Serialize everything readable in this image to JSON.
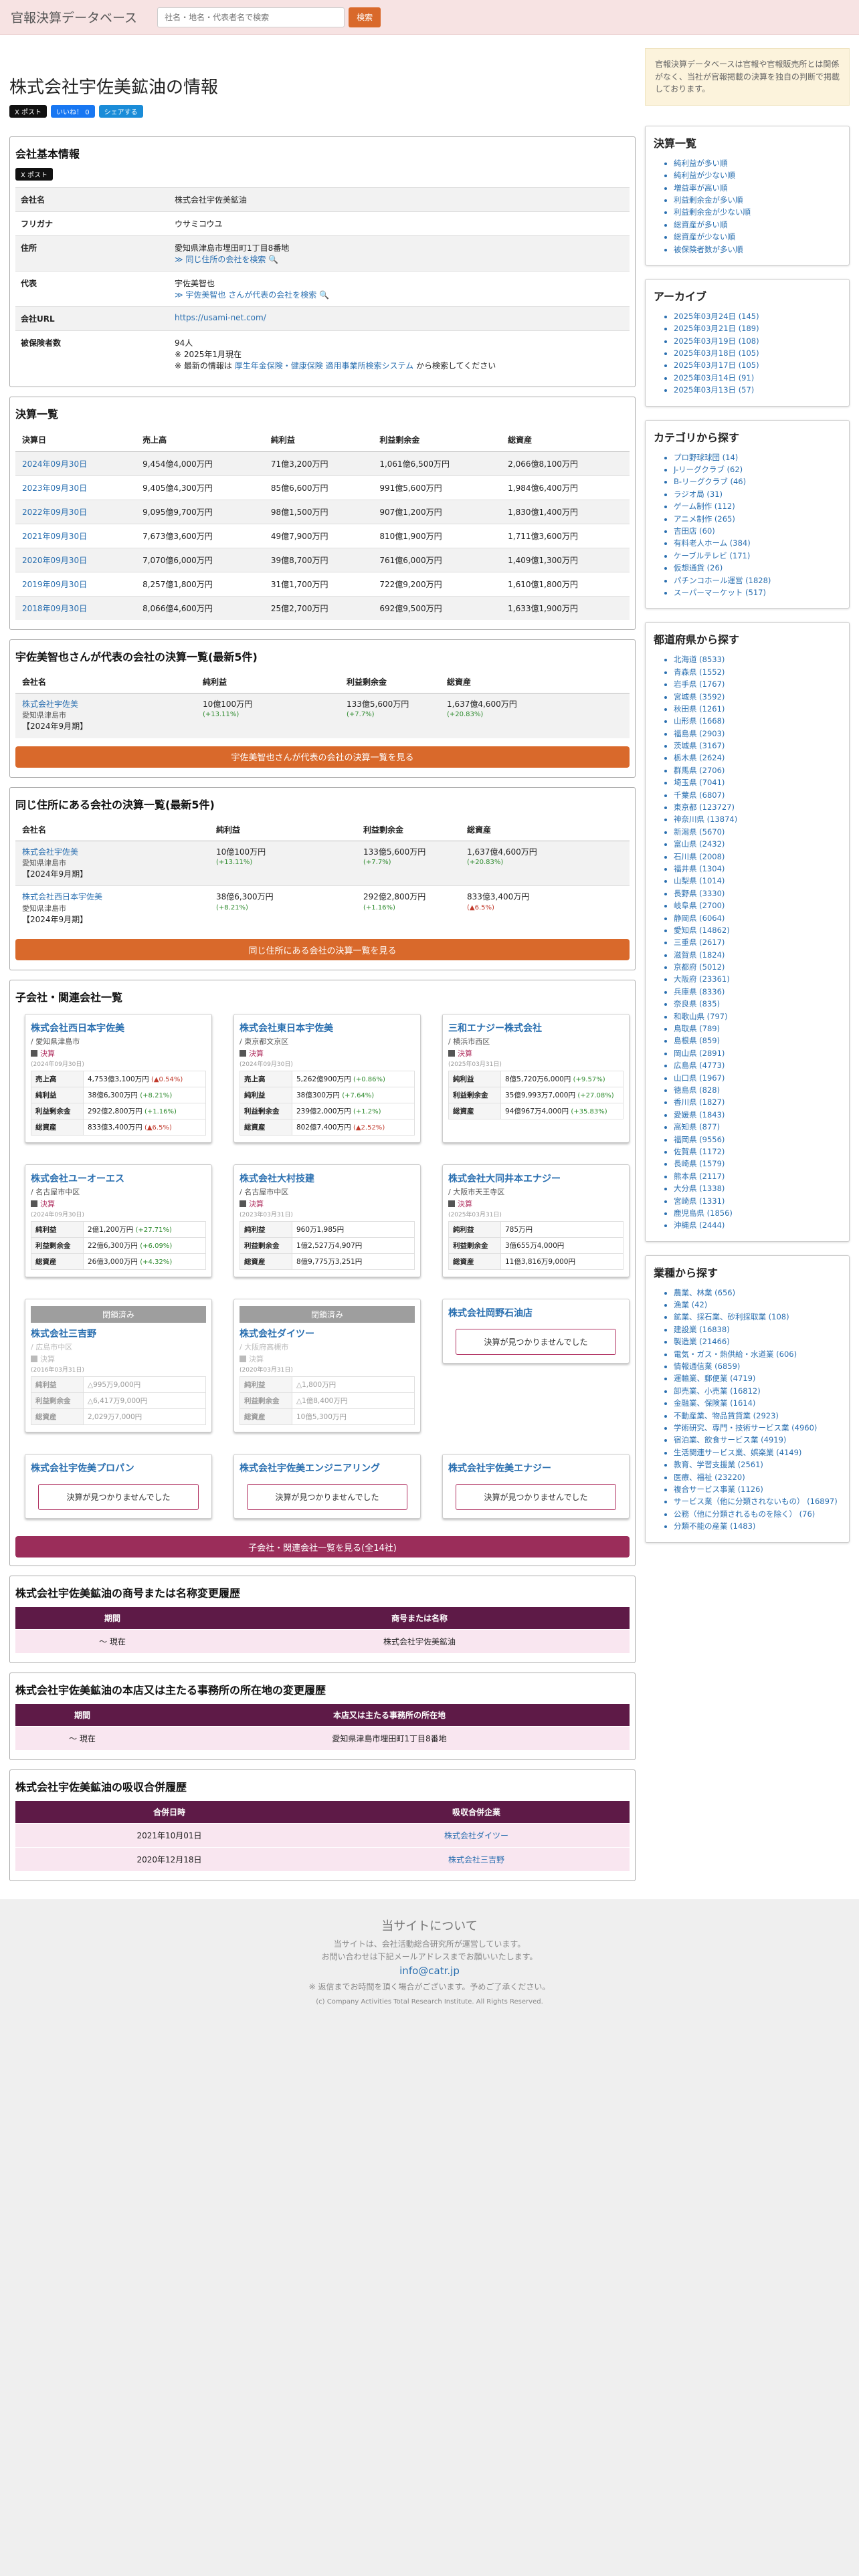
{
  "header": {
    "brand": "官報決算データベース",
    "search_placeholder": "社名・地名・代表者名で検索",
    "search_button": "検索"
  },
  "page_title": "株式会社宇佐美鉱油の情報",
  "social": {
    "post": "X ポスト",
    "like": "いいね！ 0",
    "share": "シェアする"
  },
  "basic": {
    "title": "会社基本情報",
    "post_label": "X ポスト",
    "rows": [
      {
        "k": "会社名",
        "v": "株式会社宇佐美鉱油"
      },
      {
        "k": "フリガナ",
        "v": "ウサミコウユ"
      },
      {
        "k": "住所",
        "v": "愛知県津島市埋田町1丁目8番地",
        "link": "≫ 同じ住所の会社を検索 🔍"
      },
      {
        "k": "代表",
        "v": "宇佐美智也",
        "link": "≫ 宇佐美智也 さんが代表の会社を検索 🔍"
      },
      {
        "k": "会社URL",
        "v": "https://usami-net.com/"
      },
      {
        "k": "被保険者数",
        "v": "94人",
        "v2": "※ 2025年1月現在",
        "v3a": "※ 最新の情報は ",
        "v3link": "厚生年金保険・健康保険 適用事業所検索システム",
        "v3b": " から検索してください"
      }
    ]
  },
  "results": {
    "title": "決算一覧",
    "headers": [
      "決算日",
      "売上高",
      "純利益",
      "利益剰余金",
      "総資産"
    ],
    "rows": [
      [
        "2024年09月30日",
        "9,454億4,000万円",
        "71億3,200万円",
        "1,061億6,500万円",
        "2,066億8,100万円"
      ],
      [
        "2023年09月30日",
        "9,405億4,300万円",
        "85億6,600万円",
        "991億5,600万円",
        "1,984億6,400万円"
      ],
      [
        "2022年09月30日",
        "9,095億9,700万円",
        "98億1,500万円",
        "907億1,200万円",
        "1,830億1,400万円"
      ],
      [
        "2021年09月30日",
        "7,673億3,600万円",
        "49億7,900万円",
        "810億1,900万円",
        "1,711億3,600万円"
      ],
      [
        "2020年09月30日",
        "7,070億6,000万円",
        "39億8,700万円",
        "761億6,000万円",
        "1,409億1,300万円"
      ],
      [
        "2019年09月30日",
        "8,257億1,800万円",
        "31億1,700万円",
        "722億9,200万円",
        "1,610億1,800万円"
      ],
      [
        "2018年09月30日",
        "8,066億4,600万円",
        "25億2,700万円",
        "692億9,500万円",
        "1,633億1,900万円"
      ]
    ]
  },
  "rep": {
    "title": "宇佐美智也さんが代表の会社の決算一覧(最新5件)",
    "headers": [
      "会社名",
      "純利益",
      "利益剰余金",
      "総資産"
    ],
    "rows": [
      {
        "name": "株式会社宇佐美",
        "pref": "愛知県津島市",
        "date": "【2024年9月期】",
        "net": "10億100万円",
        "net_d": "(+13.11%)",
        "ret": "133億5,600万円",
        "ret_d": "(+7.7%)",
        "tot": "1,637億4,600万円",
        "tot_d": "(+20.83%)"
      }
    ],
    "button": "宇佐美智也さんが代表の会社の決算一覧を見る"
  },
  "same_addr": {
    "title": "同じ住所にある会社の決算一覧(最新5件)",
    "headers": [
      "会社名",
      "純利益",
      "利益剰余金",
      "総資産"
    ],
    "rows": [
      {
        "name": "株式会社宇佐美",
        "pref": "愛知県津島市",
        "date": "【2024年9月期】",
        "net": "10億100万円",
        "net_d": "(+13.11%)",
        "ret": "133億5,600万円",
        "ret_d": "(+7.7%)",
        "tot": "1,637億4,600万円",
        "tot_d": "(+20.83%)"
      },
      {
        "name": "株式会社西日本宇佐美",
        "pref": "愛知県津島市",
        "date": "【2024年9月期】",
        "net": "38億6,300万円",
        "net_d": "(+8.21%)",
        "ret": "292億2,800万円",
        "ret_d": "(+1.16%)",
        "tot": "833億3,400万円",
        "tot_d": "(▲6.5%)"
      }
    ],
    "button": "同じ住所にある会社の決算一覧を見る"
  },
  "subsid": {
    "title": "子会社・関連会社一覧",
    "kessan_label": "決算",
    "closed_label": "閉鎖済み",
    "no_result": "決算が見つかりませんでした",
    "labels": {
      "sales": "売上高",
      "net": "純利益",
      "ret": "利益剰余金",
      "tot": "総資産"
    },
    "cards": [
      {
        "name": "株式会社西日本宇佐美",
        "loc": "/ 愛知県津島市",
        "date": "(2024年09月30日)",
        "sales": "4,753億3,100万円",
        "sales_d": "(▲0.54%)",
        "net": "38億6,300万円",
        "net_d": "(+8.21%)",
        "ret": "292億2,800万円",
        "ret_d": "(+1.16%)",
        "tot": "833億3,400万円",
        "tot_d": "(▲6.5%)"
      },
      {
        "name": "株式会社東日本宇佐美",
        "loc": "/ 東京都文京区",
        "date": "(2024年09月30日)",
        "sales": "5,262億900万円",
        "sales_d": "(+0.86%)",
        "net": "38億300万円",
        "net_d": "(+7.64%)",
        "ret": "239億2,000万円",
        "ret_d": "(+1.2%)",
        "tot": "802億7,400万円",
        "tot_d": "(▲2.52%)"
      },
      {
        "name": "三和エナジー株式会社",
        "loc": "/ 横浜市西区",
        "date": "(2025年03月31日)",
        "net": "8億5,720万6,000円",
        "net_d": "(+9.57%)",
        "ret": "35億9,993万7,000円",
        "ret_d": "(+27.08%)",
        "tot": "94億967万4,000円",
        "tot_d": "(+35.83%)"
      },
      {
        "name": "株式会社ユーオーエス",
        "loc": "/ 名古屋市中区",
        "date": "(2024年09月30日)",
        "net": "2億1,200万円",
        "net_d": "(+27.71%)",
        "ret": "22億6,300万円",
        "ret_d": "(+6.09%)",
        "tot": "26億3,000万円",
        "tot_d": "(+4.32%)"
      },
      {
        "name": "株式会社大村技建",
        "loc": "/ 名古屋市中区",
        "date": "(2023年03月31日)",
        "net": "960万1,985円",
        "ret": "1億2,527万4,907円",
        "tot": "8億9,775万3,251円"
      },
      {
        "name": "株式会社大同井本エナジー",
        "loc": "/ 大阪市天王寺区",
        "date": "(2025年03月31日)",
        "net": "785万円",
        "ret": "3億655万4,000円",
        "tot": "11億3,816万9,000円"
      },
      {
        "name": "株式会社三吉野",
        "loc": "/ 広島市中区",
        "date": "(2016年03月31日)",
        "net": "△995万9,000円",
        "ret": "△6,417万9,000円",
        "tot": "2,029万7,000円"
      },
      {
        "name": "株式会社ダイツー",
        "loc": "/ 大阪府高槻市",
        "date": "(2020年03月31日)",
        "net": "△1,800万円",
        "ret": "△1億8,400万円",
        "tot": "10億5,300万円"
      },
      {
        "name": "株式会社岡野石油店"
      },
      {
        "name": "株式会社宇佐美プロパン"
      },
      {
        "name": "株式会社宇佐美エンジニアリング"
      },
      {
        "name": "株式会社宇佐美エナジー"
      }
    ],
    "button": "子会社・関連会社一覧を見る(全14社)"
  },
  "name_hist": {
    "title": "株式会社宇佐美鉱油の商号または名称変更履歴",
    "headers": [
      "期間",
      "商号または名称"
    ],
    "rows": [
      [
        "〜 現在",
        "株式会社宇佐美鉱油"
      ]
    ]
  },
  "addr_hist": {
    "title": "株式会社宇佐美鉱油の本店又は主たる事務所の所在地の変更履歴",
    "headers": [
      "期間",
      "本店又は主たる事務所の所在地"
    ],
    "rows": [
      [
        "〜 現在",
        "愛知県津島市埋田町1丁目8番地"
      ]
    ]
  },
  "merge_hist": {
    "title": "株式会社宇佐美鉱油の吸収合併履歴",
    "headers": [
      "合併日時",
      "吸収合併企業"
    ],
    "rows": [
      [
        "2021年10月01日",
        "株式会社ダイツー"
      ],
      [
        "2020年12月18日",
        "株式会社三吉野"
      ]
    ]
  },
  "sidebar": {
    "notice": "官報決算データベースは官報や官報販売所とは関係がなく、当社が官報掲載の決算を独自の判断で掲載しております。",
    "results_title": "決算一覧",
    "results_items": [
      "純利益が多い順",
      "純利益が少ない順",
      "増益率が高い順",
      "利益剰余金が多い順",
      "利益剰余金が少ない順",
      "総資産が多い順",
      "総資産が少ない順",
      "被保険者数が多い順"
    ],
    "archive_title": "アーカイブ",
    "archive_items": [
      "2025年03月24日 (145)",
      "2025年03月21日 (189)",
      "2025年03月19日 (108)",
      "2025年03月18日 (105)",
      "2025年03月17日 (105)",
      "2025年03月14日 (91)",
      "2025年03月13日 (57)"
    ],
    "category_title": "カテゴリから探す",
    "category_items": [
      "プロ野球球団 (14)",
      "J-リーグクラブ (62)",
      "B-リーグクラブ (46)",
      "ラジオ局 (31)",
      "ゲーム制作 (112)",
      "アニメ制作 (265)",
      "吉田店 (60)",
      "有料老人ホーム (384)",
      "ケーブルテレビ (171)",
      "仮想通貨 (26)",
      "パチンコホール運営 (1828)",
      "スーパーマーケット (517)"
    ],
    "pref_title": "都道府県から探す",
    "pref_items": [
      "北海道 (8533)",
      "青森県 (1552)",
      "岩手県 (1767)",
      "宮城県 (3592)",
      "秋田県 (1261)",
      "山形県 (1668)",
      "福島県 (2903)",
      "茨城県 (3167)",
      "栃木県 (2624)",
      "群馬県 (2706)",
      "埼玉県 (7041)",
      "千葉県 (6807)",
      "東京都 (123727)",
      "神奈川県 (13874)",
      "新潟県 (5670)",
      "富山県 (2432)",
      "石川県 (2008)",
      "福井県 (1304)",
      "山梨県 (1014)",
      "長野県 (3330)",
      "岐阜県 (2700)",
      "静岡県 (6064)",
      "愛知県 (14862)",
      "三重県 (2617)",
      "滋賀県 (1824)",
      "京都府 (5012)",
      "大阪府 (23361)",
      "兵庫県 (8336)",
      "奈良県 (835)",
      "和歌山県 (797)",
      "鳥取県 (789)",
      "島根県 (859)",
      "岡山県 (2891)",
      "広島県 (4773)",
      "山口県 (1967)",
      "徳島県 (828)",
      "香川県 (1827)",
      "愛媛県 (1843)",
      "高知県 (877)",
      "福岡県 (9556)",
      "佐賀県 (1172)",
      "長崎県 (1579)",
      "熊本県 (2117)",
      "大分県 (1338)",
      "宮崎県 (1331)",
      "鹿児島県 (1856)",
      "沖縄県 (2444)"
    ],
    "industry_title": "業種から探す",
    "industry_items": [
      "農業、林業 (656)",
      "漁業 (42)",
      "鉱業、採石業、砂利採取業 (108)",
      "建設業 (16838)",
      "製造業 (21466)",
      "電気・ガス・熱供給・水道業 (606)",
      "情報通信業 (6859)",
      "運輸業、郵便業 (4719)",
      "卸売業、小売業 (16812)",
      "金融業、保険業 (1614)",
      "不動産業、物品賃貸業 (2923)",
      "学術研究、専門・技術サービス業 (4960)",
      "宿泊業、飲食サービス業 (4919)",
      "生活関連サービス業、娯楽業 (4149)",
      "教育、学習支援業 (2561)",
      "医療、福祉 (23220)",
      "複合サービス事業 (1126)",
      "サービス業（他に分類されないもの） (16897)",
      "公務（他に分類されるものを除く） (76)",
      "分類不能の産業 (1483)"
    ]
  },
  "footer": {
    "title": "当サイトについて",
    "line1": "当サイトは、会社活動総合研究所が運営しています。",
    "line2": "お問い合わせは下記メールアドレスまでお願いいたします。",
    "mail": "info@catr.jp",
    "note": "※ 返信までお時間を頂く場合がございます。予めご了承ください。",
    "copy": "(c) Company Activities Total Research Institute. All Rights Reserved."
  }
}
